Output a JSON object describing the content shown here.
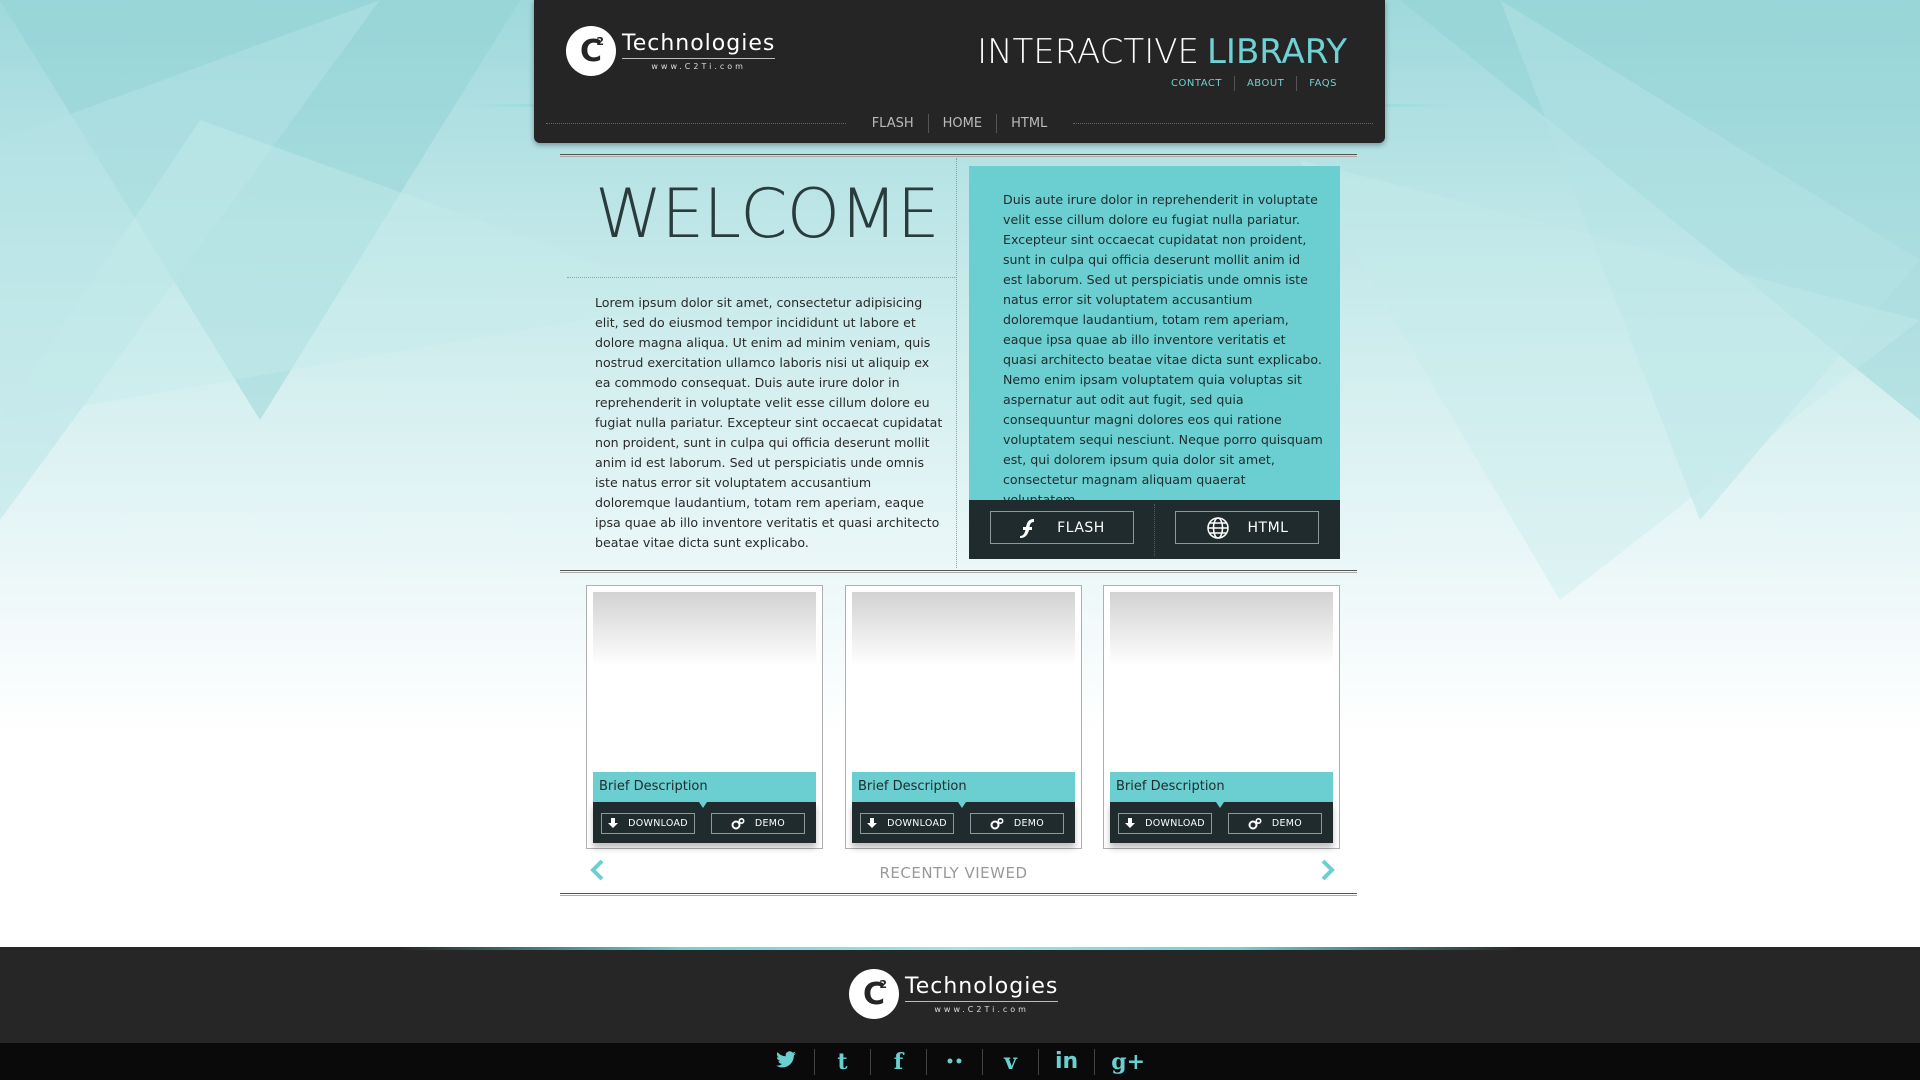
{
  "header": {
    "logo": {
      "mark": "C",
      "sup": "2",
      "title": "Technologies",
      "url": "www.C2Ti.com"
    },
    "site_title_white": "INTERACTIVE",
    "site_title_accent": "LIBRARY",
    "top_links": [
      "CONTACT",
      "ABOUT",
      "FAQS"
    ],
    "nav": [
      "FLASH",
      "HOME",
      "HTML"
    ]
  },
  "main": {
    "welcome": "WELCOME",
    "intro": "Lorem ipsum dolor sit amet, consectetur adipisicing elit, sed do eiusmod tempor incididunt ut labore et dolore magna aliqua. Ut enim ad minim veniam, quis nostrud exercitation ullamco laboris nisi ut aliquip ex ea commodo consequat. Duis aute irure dolor in reprehenderit in voluptate velit esse cillum dolore eu fugiat nulla pariatur. Excepteur sint occaecat cupidatat non proident, sunt in culpa qui officia deserunt mollit anim id est laborum. Sed ut perspiciatis unde omnis iste natus error sit voluptatem accusantium doloremque laudantium, totam rem aperiam, eaque ipsa quae ab illo inventore veritatis et quasi architecto beatae vitae dicta sunt explicabo.",
    "feature_text": "Duis aute irure dolor in reprehenderit in voluptate velit esse cillum dolore eu fugiat nulla pariatur. Excepteur sint occaecat cupidatat non proident, sunt in culpa qui officia deserunt mollit anim id est laborum. Sed ut perspiciatis unde omnis iste natus error sit voluptatem accusantium doloremque laudantium, totam rem aperiam, eaque ipsa quae ab illo inventore veritatis et quasi architecto beatae vitae dicta sunt explicabo. Nemo enim ipsam voluptatem quia voluptas sit aspernatur aut odit aut fugit, sed quia consequuntur magni dolores eos qui ratione voluptatem sequi nesciunt. Neque porro quisquam est, qui dolorem ipsum quia dolor sit amet, consectetur magnam aliquam quaerat voluptatem.",
    "flash_button": "FLASH",
    "html_button": "HTML"
  },
  "cards": [
    {
      "description": "Brief Description",
      "download": "DOWNLOAD",
      "demo": "DEMO"
    },
    {
      "description": "Brief Description",
      "download": "DOWNLOAD",
      "demo": "DEMO"
    },
    {
      "description": "Brief Description",
      "download": "DOWNLOAD",
      "demo": "DEMO"
    }
  ],
  "recently_viewed": "RECENTLY VIEWED",
  "footer": {
    "logo": {
      "mark": "C",
      "sup": "2",
      "title": "Technologies",
      "url": "www.C2Ti.com"
    },
    "social": [
      {
        "icon": "twitter-icon",
        "glyph": "🐦"
      },
      {
        "icon": "tumblr-icon",
        "glyph": "t"
      },
      {
        "icon": "facebook-icon",
        "glyph": "f"
      },
      {
        "icon": "flickr-icon",
        "glyph": "••"
      },
      {
        "icon": "vimeo-icon",
        "glyph": "v"
      },
      {
        "icon": "linkedin-icon",
        "glyph": "in"
      },
      {
        "icon": "googleplus-icon",
        "glyph": "g+"
      }
    ]
  },
  "colors": {
    "accent": "#6bcfd1",
    "dark": "#252525",
    "panel": "#1f2b2c"
  }
}
